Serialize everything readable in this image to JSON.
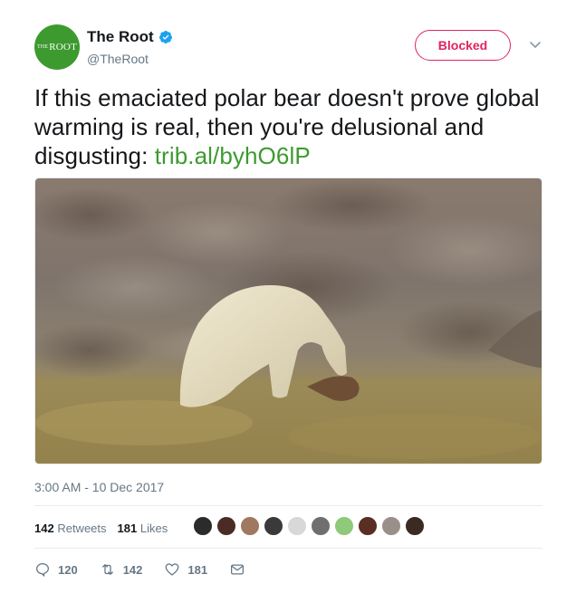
{
  "author": {
    "avatar_text_small": "THE",
    "avatar_text": "ROOT",
    "display_name": "The Root",
    "handle": "@TheRoot",
    "verified_icon": "verified-badge-icon"
  },
  "follow_button": {
    "label": "Blocked"
  },
  "tweet": {
    "text": "If this emaciated polar bear doesn't prove global warming is real, then you're delusional and disgusting: ",
    "link_text": "trib.al/byhO6lP",
    "timestamp": "3:00 AM - 10 Dec 2017"
  },
  "stats": {
    "retweets_count": "142",
    "retweets_label": "Retweets",
    "likes_count": "181",
    "likes_label": "Likes"
  },
  "likers": [
    {
      "icon": "liker-avatar-1",
      "color": "#2b2b2b"
    },
    {
      "icon": "liker-avatar-2",
      "color": "#4a2c24"
    },
    {
      "icon": "liker-avatar-3",
      "color": "#a07860"
    },
    {
      "icon": "liker-avatar-4",
      "color": "#3a3a3a"
    },
    {
      "icon": "liker-avatar-5",
      "color": "#d8d8d8"
    },
    {
      "icon": "liker-avatar-6",
      "color": "#6f6f6f"
    },
    {
      "icon": "liker-avatar-7",
      "color": "#8fc97a"
    },
    {
      "icon": "liker-avatar-8",
      "color": "#5a2e22"
    },
    {
      "icon": "liker-avatar-9",
      "color": "#9b8f8a"
    },
    {
      "icon": "liker-avatar-10",
      "color": "#3b2a20"
    }
  ],
  "actions": {
    "reply_count": "120",
    "retweet_count": "142",
    "like_count": "181"
  },
  "colors": {
    "brand_green": "#3d9a2f",
    "blocked_red": "#e0245e",
    "verified_blue": "#1da1f2",
    "secondary_text": "#657786"
  }
}
